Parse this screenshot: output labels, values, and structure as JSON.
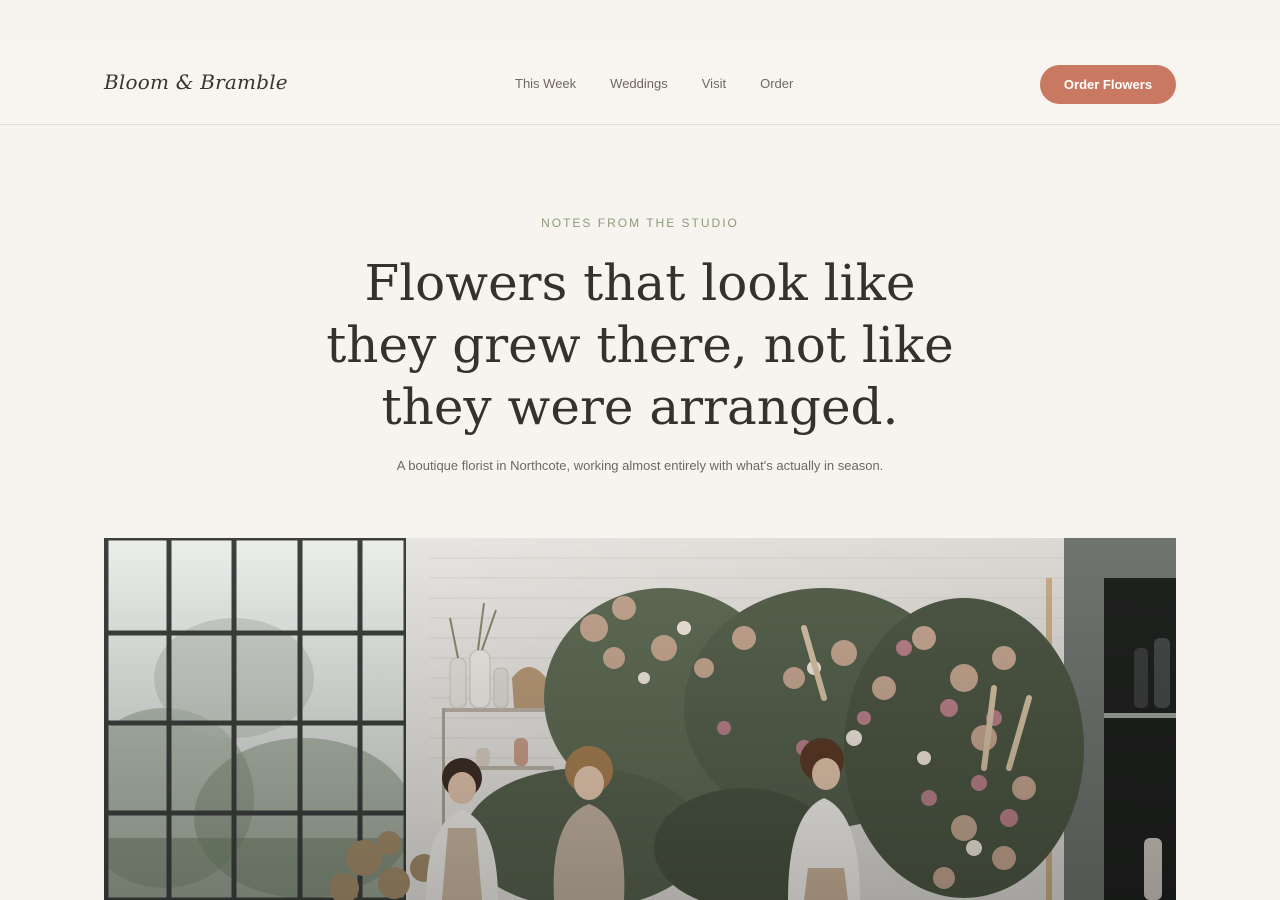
{
  "brand": {
    "name": "Bloom & Bramble"
  },
  "nav": {
    "items": [
      {
        "label": "This Week"
      },
      {
        "label": "Weddings"
      },
      {
        "label": "Visit"
      },
      {
        "label": "Order"
      }
    ],
    "cta_label": "Order Flowers"
  },
  "hero": {
    "eyebrow": "NOTES FROM THE STUDIO",
    "headline": "Flowers that look like they grew there, not like they were arranged.",
    "subline": "A boutique florist in Northcote, working almost entirely with what's actually in season.",
    "image_subject": "florists arranging a large dried-and-fresh flower installation in a sunlit studio"
  },
  "colors": {
    "background": "#f7f4ef",
    "accent": "#c97862",
    "eyebrow": "#8c9c7a",
    "text": "#36312b"
  }
}
